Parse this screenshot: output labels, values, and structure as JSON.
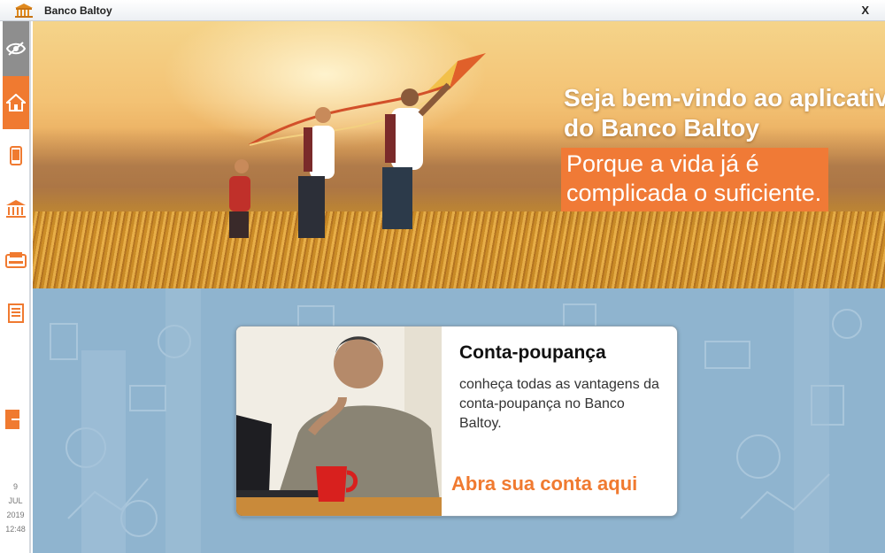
{
  "window": {
    "title": "Banco Baltoy",
    "close_label": "X"
  },
  "sidebar": {
    "items": [
      {
        "name": "hide-balance",
        "icon": "eye-off-icon"
      },
      {
        "name": "home",
        "icon": "home-icon",
        "active": true
      },
      {
        "name": "phone",
        "icon": "phone-icon"
      },
      {
        "name": "bank",
        "icon": "bank-icon"
      },
      {
        "name": "atm",
        "icon": "atm-icon"
      },
      {
        "name": "statement",
        "icon": "document-icon"
      },
      {
        "name": "exit",
        "icon": "exit-icon"
      }
    ],
    "date": {
      "day": "9",
      "month": "JUL",
      "year": "2019",
      "time": "12:48"
    }
  },
  "hero": {
    "headline": "Seja bem-vindo ao aplicativo do Banco Baltoy",
    "tagline_line1": "Porque a vida já é",
    "tagline_line2": "complicada o suficiente."
  },
  "promo": {
    "title": "Conta-poupança",
    "description": "conheça todas as vantagens da conta-poupança no Banco Baltoy.",
    "cta": "Abra sua conta aqui"
  },
  "colors": {
    "accent": "#f07a30",
    "sidebar_active": "#f07a30",
    "sidebar_inactive_icon": "#f07a30",
    "panel_bg": "#8fb4cf"
  }
}
